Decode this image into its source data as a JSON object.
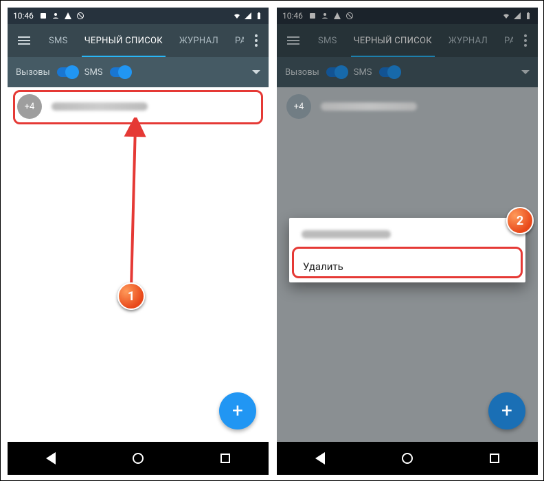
{
  "status": {
    "time": "10:46"
  },
  "tabs": {
    "sms": "SMS",
    "blacklist": "ЧЕРНЫЙ СПИСОК",
    "journal": "ЖУРНАЛ",
    "partial": "РА"
  },
  "filter": {
    "calls_label": "Вызовы",
    "sms_label": "SMS"
  },
  "list": {
    "avatar_badge": "+4"
  },
  "dialog": {
    "delete_label": "Удалить"
  },
  "fab": {
    "plus": "+"
  },
  "markers": {
    "one": "1",
    "two": "2"
  }
}
